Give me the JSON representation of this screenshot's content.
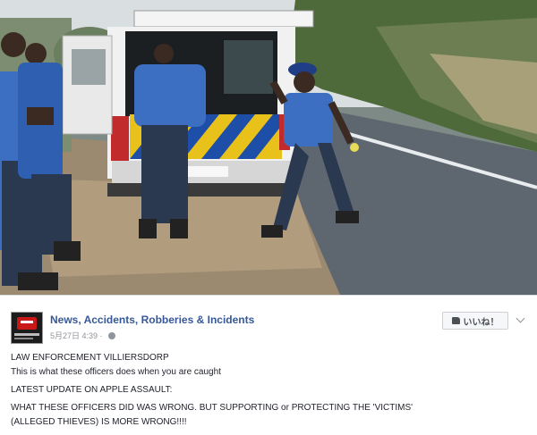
{
  "post": {
    "page_name": "News, Accidents, Robberies & Incidents",
    "timestamp": "5月27日 4:39 · ",
    "like_label": "いいね！",
    "lines": [
      "LAW ENFORCEMENT VILLIERSDORP",
      "This is what these officers does when you are caught",
      "LATEST UPDATE ON APPLE ASSAULT:",
      "WHAT THESE OFFICERS DID WAS WRONG. BUT SUPPORTING or PROTECTING THE 'VICTIMS'",
      "(ALLEGED THIEVES) IS MORE WRONG!!!!"
    ]
  },
  "icons": {
    "avatar": "news-page-avatar",
    "privacy": "globe-icon",
    "like": "thumb-icon",
    "menu": "chevron-down-icon"
  },
  "colors": {
    "link": "#365899",
    "body_text": "#1d2129",
    "meta_text": "#90949c",
    "uniform": "#2f5fb0",
    "vehicle_stripe_yellow": "#e8c21a",
    "vehicle_stripe_blue": "#1d4ea8"
  }
}
